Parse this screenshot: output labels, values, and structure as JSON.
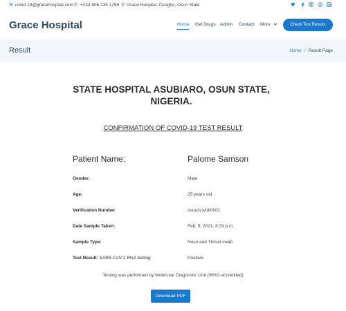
{
  "topbar": {
    "email": "covid-19@gracehospital.com",
    "phone": "+234 906 235 1255",
    "location": "Grace Hospital, Osogbo, Osun State",
    "social": [
      "twitter",
      "facebook",
      "instagram",
      "skype",
      "linkedin"
    ]
  },
  "header": {
    "logo": "Grace Hospital",
    "nav": [
      "Home",
      "Get Drugs",
      "Admin",
      "Contact",
      "More"
    ],
    "active_nav": "Home",
    "cta_label": "Check Test Results"
  },
  "breadcrumb": {
    "title": "Result",
    "home": "Home",
    "separator": "/",
    "current": "Result Page"
  },
  "result": {
    "hospital": "STATE HOSPITAL ASUBIARO, OSUN STATE, NIGERIA.",
    "heading": "CONFIRMATION OF COVID-19 TEST RESULT",
    "fields": [
      {
        "label": "Patient Name:",
        "value": "Palome Samson"
      },
      {
        "label": "Gender:",
        "value": "Male"
      },
      {
        "label": "Age:",
        "value": "25 years old."
      },
      {
        "label": "Verification Number",
        "value": "osun/covid/0001"
      },
      {
        "label": "Date Sample Taken:",
        "value": "Feb. 5, 2021, 8:33 p.m."
      },
      {
        "label": "Sample Type:",
        "value": "Nose and Throat swab"
      },
      {
        "label": "Test Result:",
        "label_extra": "SARS-CoV-2 RNA testing",
        "value": "Positive"
      }
    ],
    "note": "Testing was performed by Molecular Diagnostic Unit (WHO accredited)",
    "pdf_label": "Download PDF"
  },
  "colors": {
    "accent": "#1977cc",
    "heading": "#2c4964",
    "band": "#f1f7fd"
  }
}
